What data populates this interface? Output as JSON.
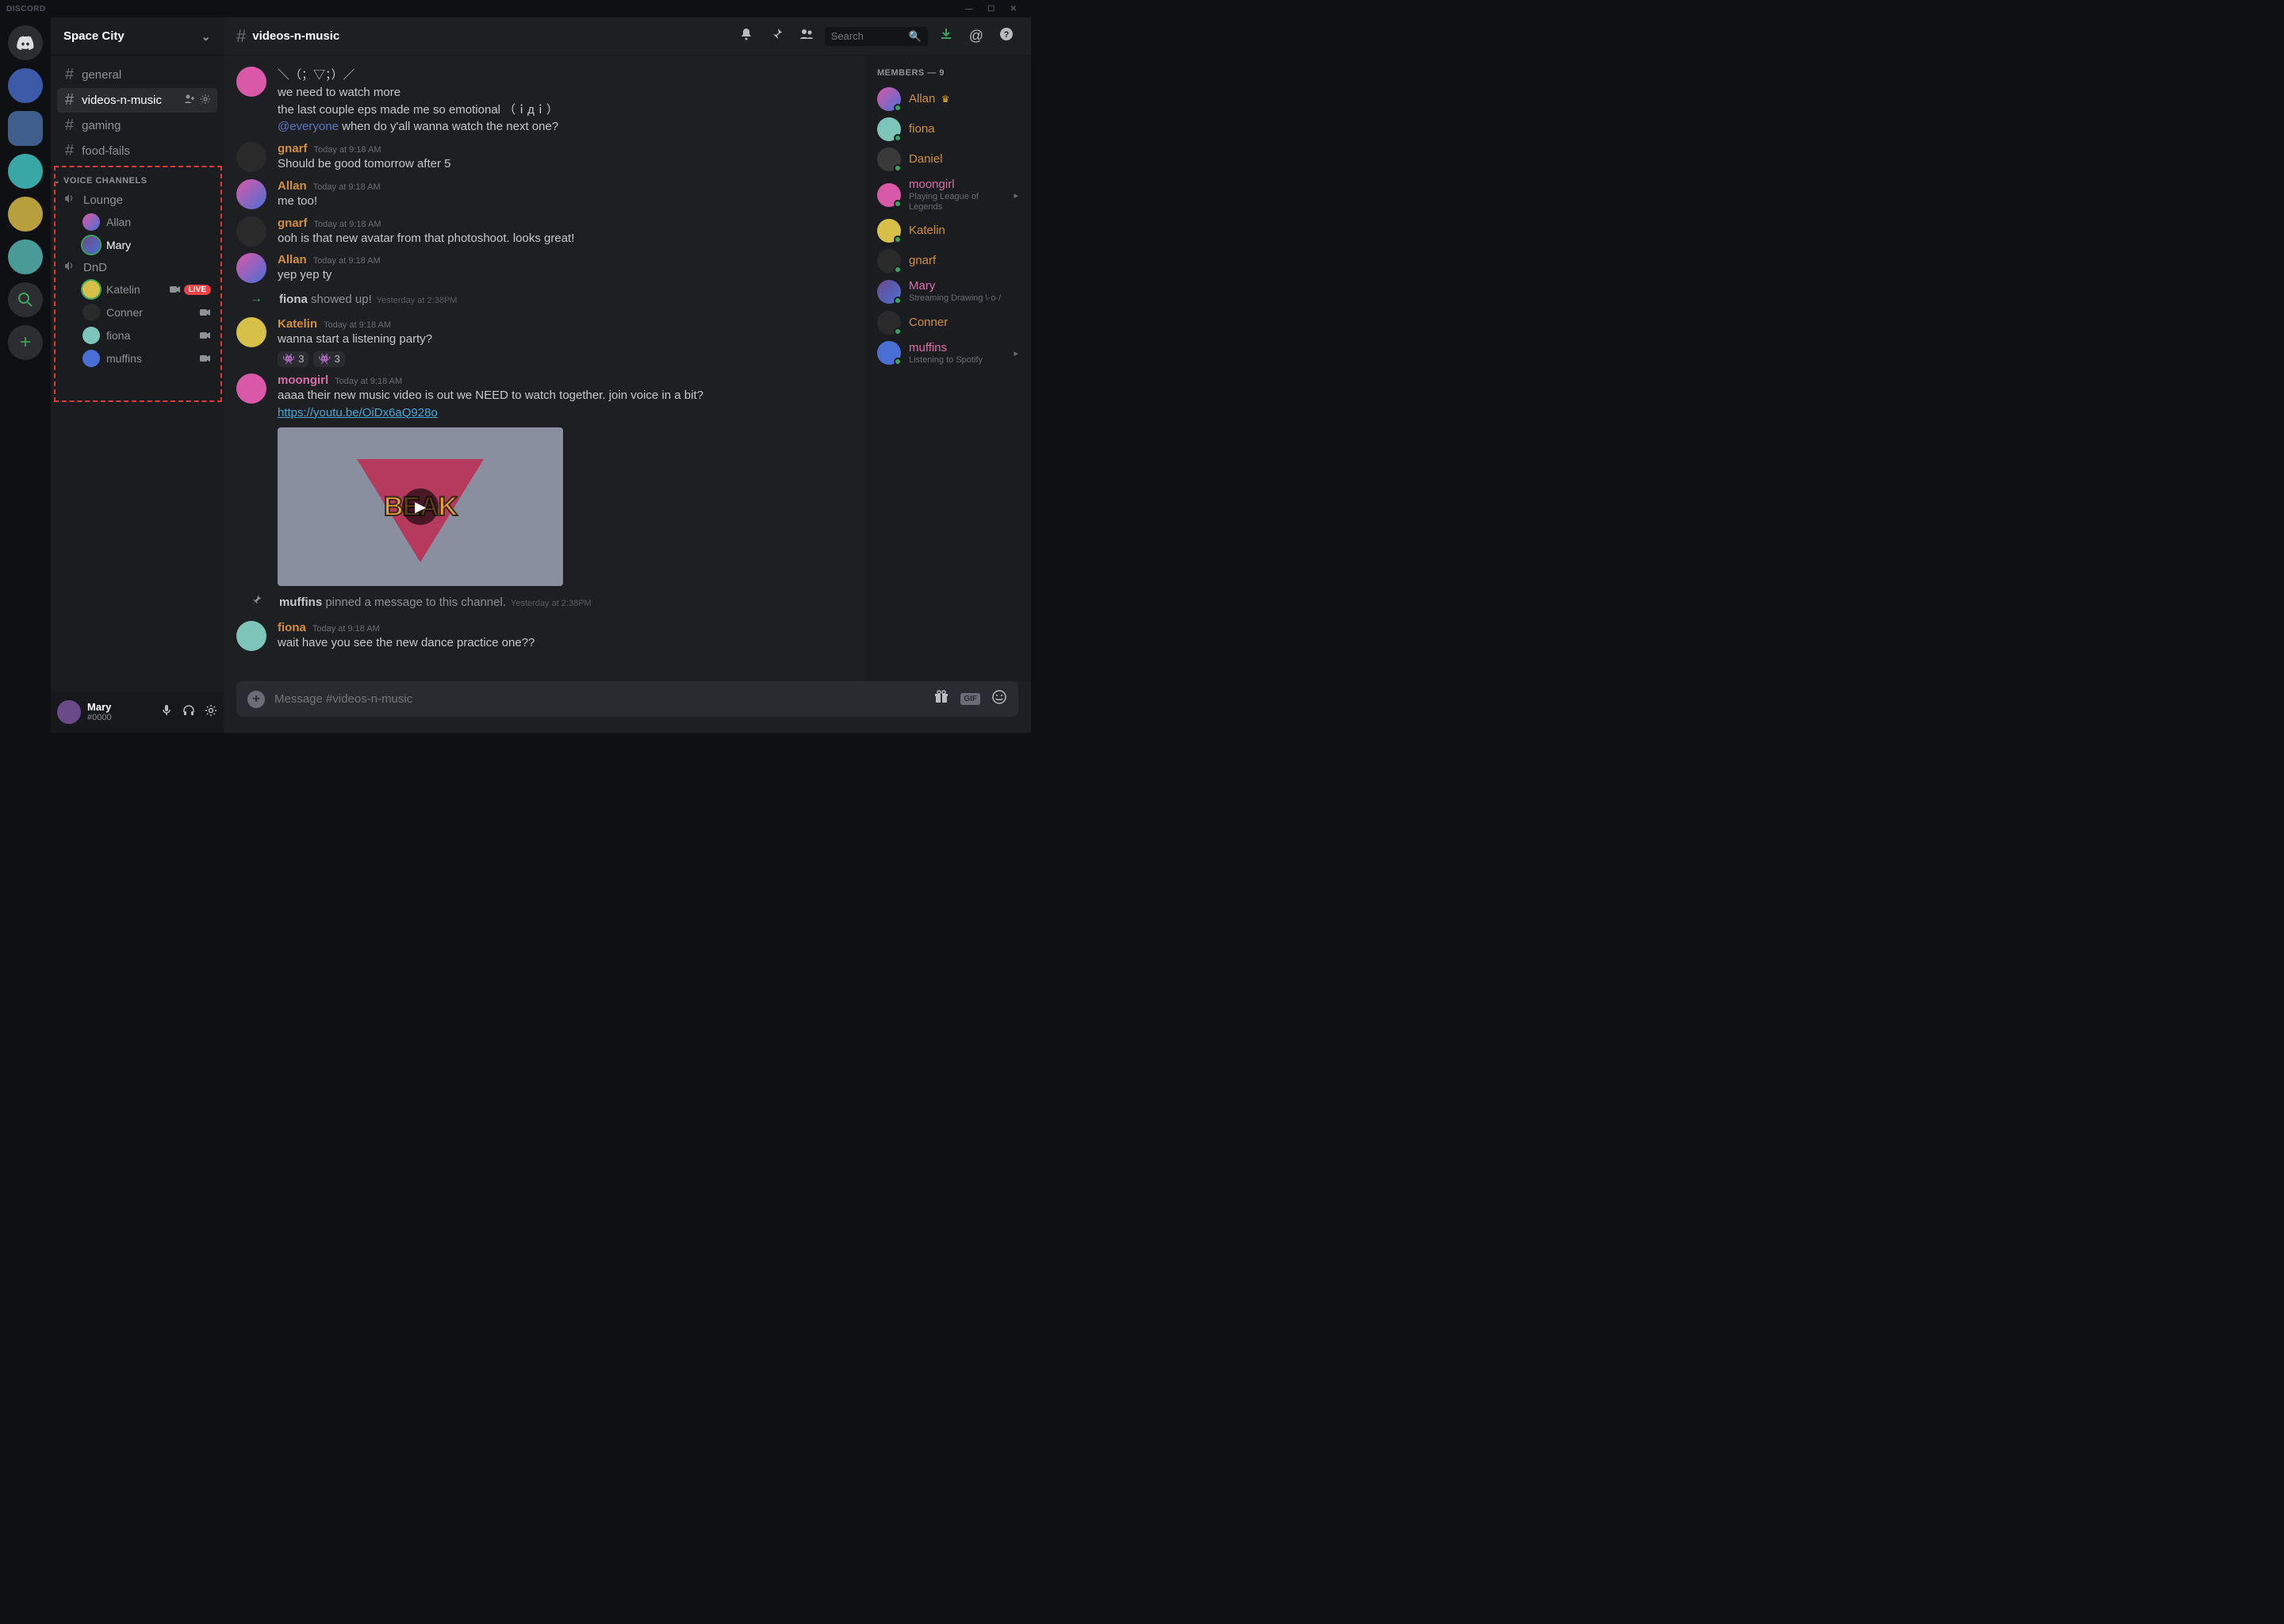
{
  "titlebar": {
    "app": "DISCORD"
  },
  "server_header": {
    "name": "Space City"
  },
  "text_channels": [
    {
      "name": "general"
    },
    {
      "name": "videos-n-music",
      "active": true
    },
    {
      "name": "gaming"
    },
    {
      "name": "food-fails"
    }
  ],
  "voice_section": {
    "label": "VOICE CHANNELS",
    "channels": [
      {
        "name": "Lounge",
        "users": [
          {
            "name": "Allan",
            "avatar": "av-allan"
          },
          {
            "name": "Mary",
            "avatar": "av-mary",
            "ring": true,
            "active": true
          }
        ]
      },
      {
        "name": "DnD",
        "users": [
          {
            "name": "Katelin",
            "avatar": "av-katelin",
            "ring": true,
            "live": true,
            "cam": true
          },
          {
            "name": "Conner",
            "avatar": "av-conner",
            "cam": true
          },
          {
            "name": "fiona",
            "avatar": "av-fiona",
            "cam": true
          },
          {
            "name": "muffins",
            "avatar": "av-muffins",
            "cam": true
          }
        ]
      }
    ],
    "live_label": "LIVE"
  },
  "user_panel": {
    "name": "Mary",
    "tag": "#0000"
  },
  "chat_header": {
    "channel": "videos-n-music",
    "search_placeholder": "Search"
  },
  "messages": [
    {
      "type": "msg",
      "author": "",
      "avatar": "av-moongirl",
      "color": "c-moongirl",
      "ts": "",
      "lines": [
        "＼（；▽；）／",
        "we need to watch more",
        "the last couple eps made me so emotional （ｉдｉ）",
        "@everyone when do y'all wanna watch the next one?"
      ]
    },
    {
      "type": "msg",
      "author": "gnarf",
      "avatar": "av-gnarf",
      "color": "c-gnarf",
      "ts": "Today at 9:18 AM",
      "lines": [
        "Should be good tomorrow after 5"
      ]
    },
    {
      "type": "msg",
      "author": "Allan",
      "avatar": "av-allan",
      "color": "c-allan",
      "ts": "Today at 9:18 AM",
      "lines": [
        "me too!"
      ]
    },
    {
      "type": "msg",
      "author": "gnarf",
      "avatar": "av-gnarf",
      "color": "c-gnarf",
      "ts": "Today at 9:18 AM",
      "lines": [
        "ooh is that new avatar from that photoshoot. looks great!"
      ]
    },
    {
      "type": "msg",
      "author": "Allan",
      "avatar": "av-allan",
      "color": "c-allan",
      "ts": "Today at 9:18 AM",
      "lines": [
        "yep yep ty"
      ]
    },
    {
      "type": "sys-join",
      "sys_prefix": "fiona",
      "sys_text": " showed up!",
      "ts": "Yesterday at 2:38PM"
    },
    {
      "type": "msg",
      "author": "Katelin",
      "avatar": "av-katelin",
      "color": "c-katelin",
      "ts": "Today at 9:18 AM",
      "lines": [
        "wanna start a listening party?"
      ],
      "reactions": [
        {
          "emoji": "👾",
          "count": "3"
        },
        {
          "emoji": "👾",
          "count": "3"
        }
      ]
    },
    {
      "type": "msg",
      "author": "moongirl",
      "avatar": "av-moongirl",
      "color": "c-moongirl",
      "ts": "Today at 9:18 AM",
      "lines": [
        "aaaa their new music video is out we NEED to watch together. join voice in a bit?"
      ],
      "link": "https://youtu.be/OiDx6aQ928o",
      "embed": {
        "logo": "BEAK"
      }
    },
    {
      "type": "sys-pin",
      "sys_prefix": "muffins",
      "sys_text": " pinned a message to this channel.",
      "ts": "Yesterday at 2:38PM"
    },
    {
      "type": "msg",
      "author": "fiona",
      "avatar": "av-fiona",
      "color": "c-fiona",
      "ts": "Today at 9:18 AM",
      "lines": [
        "wait have you see the new dance practice one??"
      ]
    }
  ],
  "message_input": {
    "placeholder": "Message #videos-n-music",
    "gif_label": "GIF"
  },
  "members": {
    "header": "MEMBERS — 9",
    "list": [
      {
        "name": "Allan",
        "avatar": "av-allan",
        "color": "c-allan",
        "crown": true
      },
      {
        "name": "fiona",
        "avatar": "av-fiona",
        "color": "c-fiona"
      },
      {
        "name": "Daniel",
        "avatar": "av-daniel",
        "color": "c-daniel"
      },
      {
        "name": "moongirl",
        "avatar": "av-moongirl",
        "color": "c-moongirl",
        "sub": "Playing League of Legends",
        "badge": true
      },
      {
        "name": "Katelin",
        "avatar": "av-katelin",
        "color": "c-katelin"
      },
      {
        "name": "gnarf",
        "avatar": "av-gnarf",
        "color": "c-gnarf"
      },
      {
        "name": "Mary",
        "avatar": "av-mary",
        "color": "c-mary",
        "sub": "Streaming Drawing \\·o·/"
      },
      {
        "name": "Conner",
        "avatar": "av-conner",
        "color": "c-conner"
      },
      {
        "name": "muffins",
        "avatar": "av-muffins",
        "color": "c-muffins",
        "sub": "Listening to Spotify",
        "badge": true
      }
    ]
  }
}
